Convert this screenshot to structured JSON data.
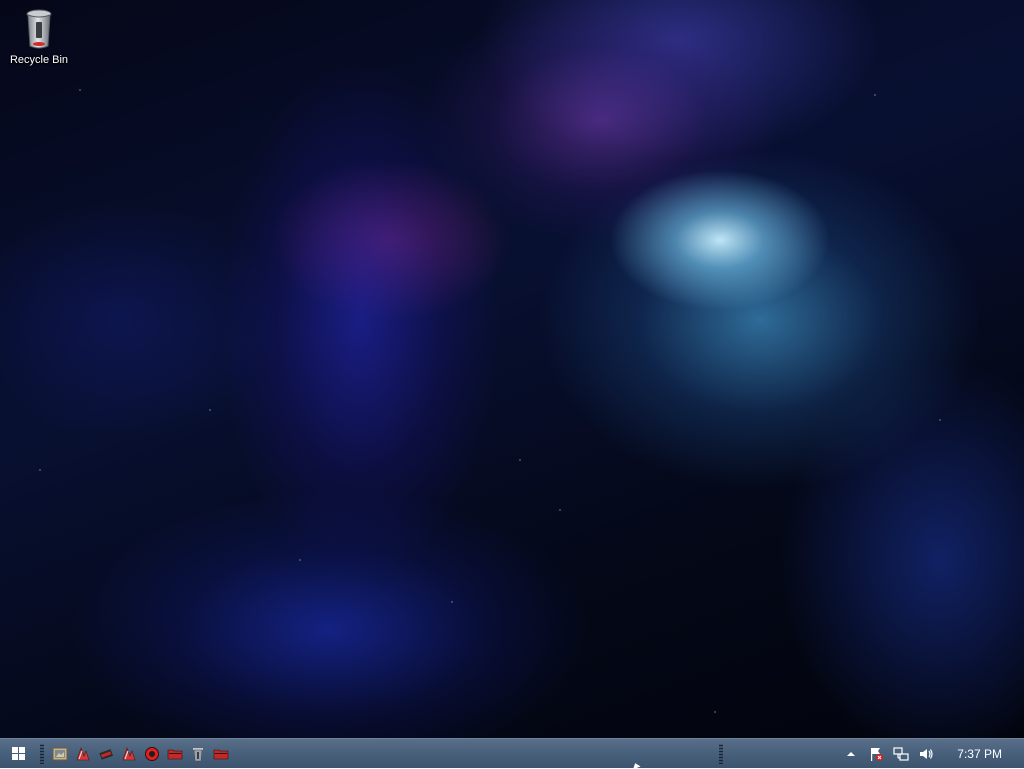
{
  "desktop": {
    "icons": [
      {
        "label": "Recycle Bin",
        "icon": "recycle-bin-icon"
      }
    ]
  },
  "taskbar": {
    "start_icon": "windows-logo-icon",
    "quick_launch": [
      {
        "icon": "picture-frame-icon",
        "color": "#c8b28a"
      },
      {
        "icon": "media-player-icon",
        "color": "#d23a3a"
      },
      {
        "icon": "pen-tool-icon",
        "color": "#c62828"
      },
      {
        "icon": "media-player-icon",
        "color": "#d23a3a"
      },
      {
        "icon": "red-circle-app-icon",
        "color": "#e02020"
      },
      {
        "icon": "red-folder-icon",
        "color": "#c62828"
      },
      {
        "icon": "trash-can-icon",
        "color": "#9aa3ad"
      },
      {
        "icon": "red-folder-icon",
        "color": "#c62828"
      }
    ],
    "tray": {
      "icons": [
        "show-hidden-icons-arrow-icon",
        "action-center-flag-icon",
        "network-icon",
        "volume-icon"
      ],
      "time": "7:37 PM"
    }
  }
}
